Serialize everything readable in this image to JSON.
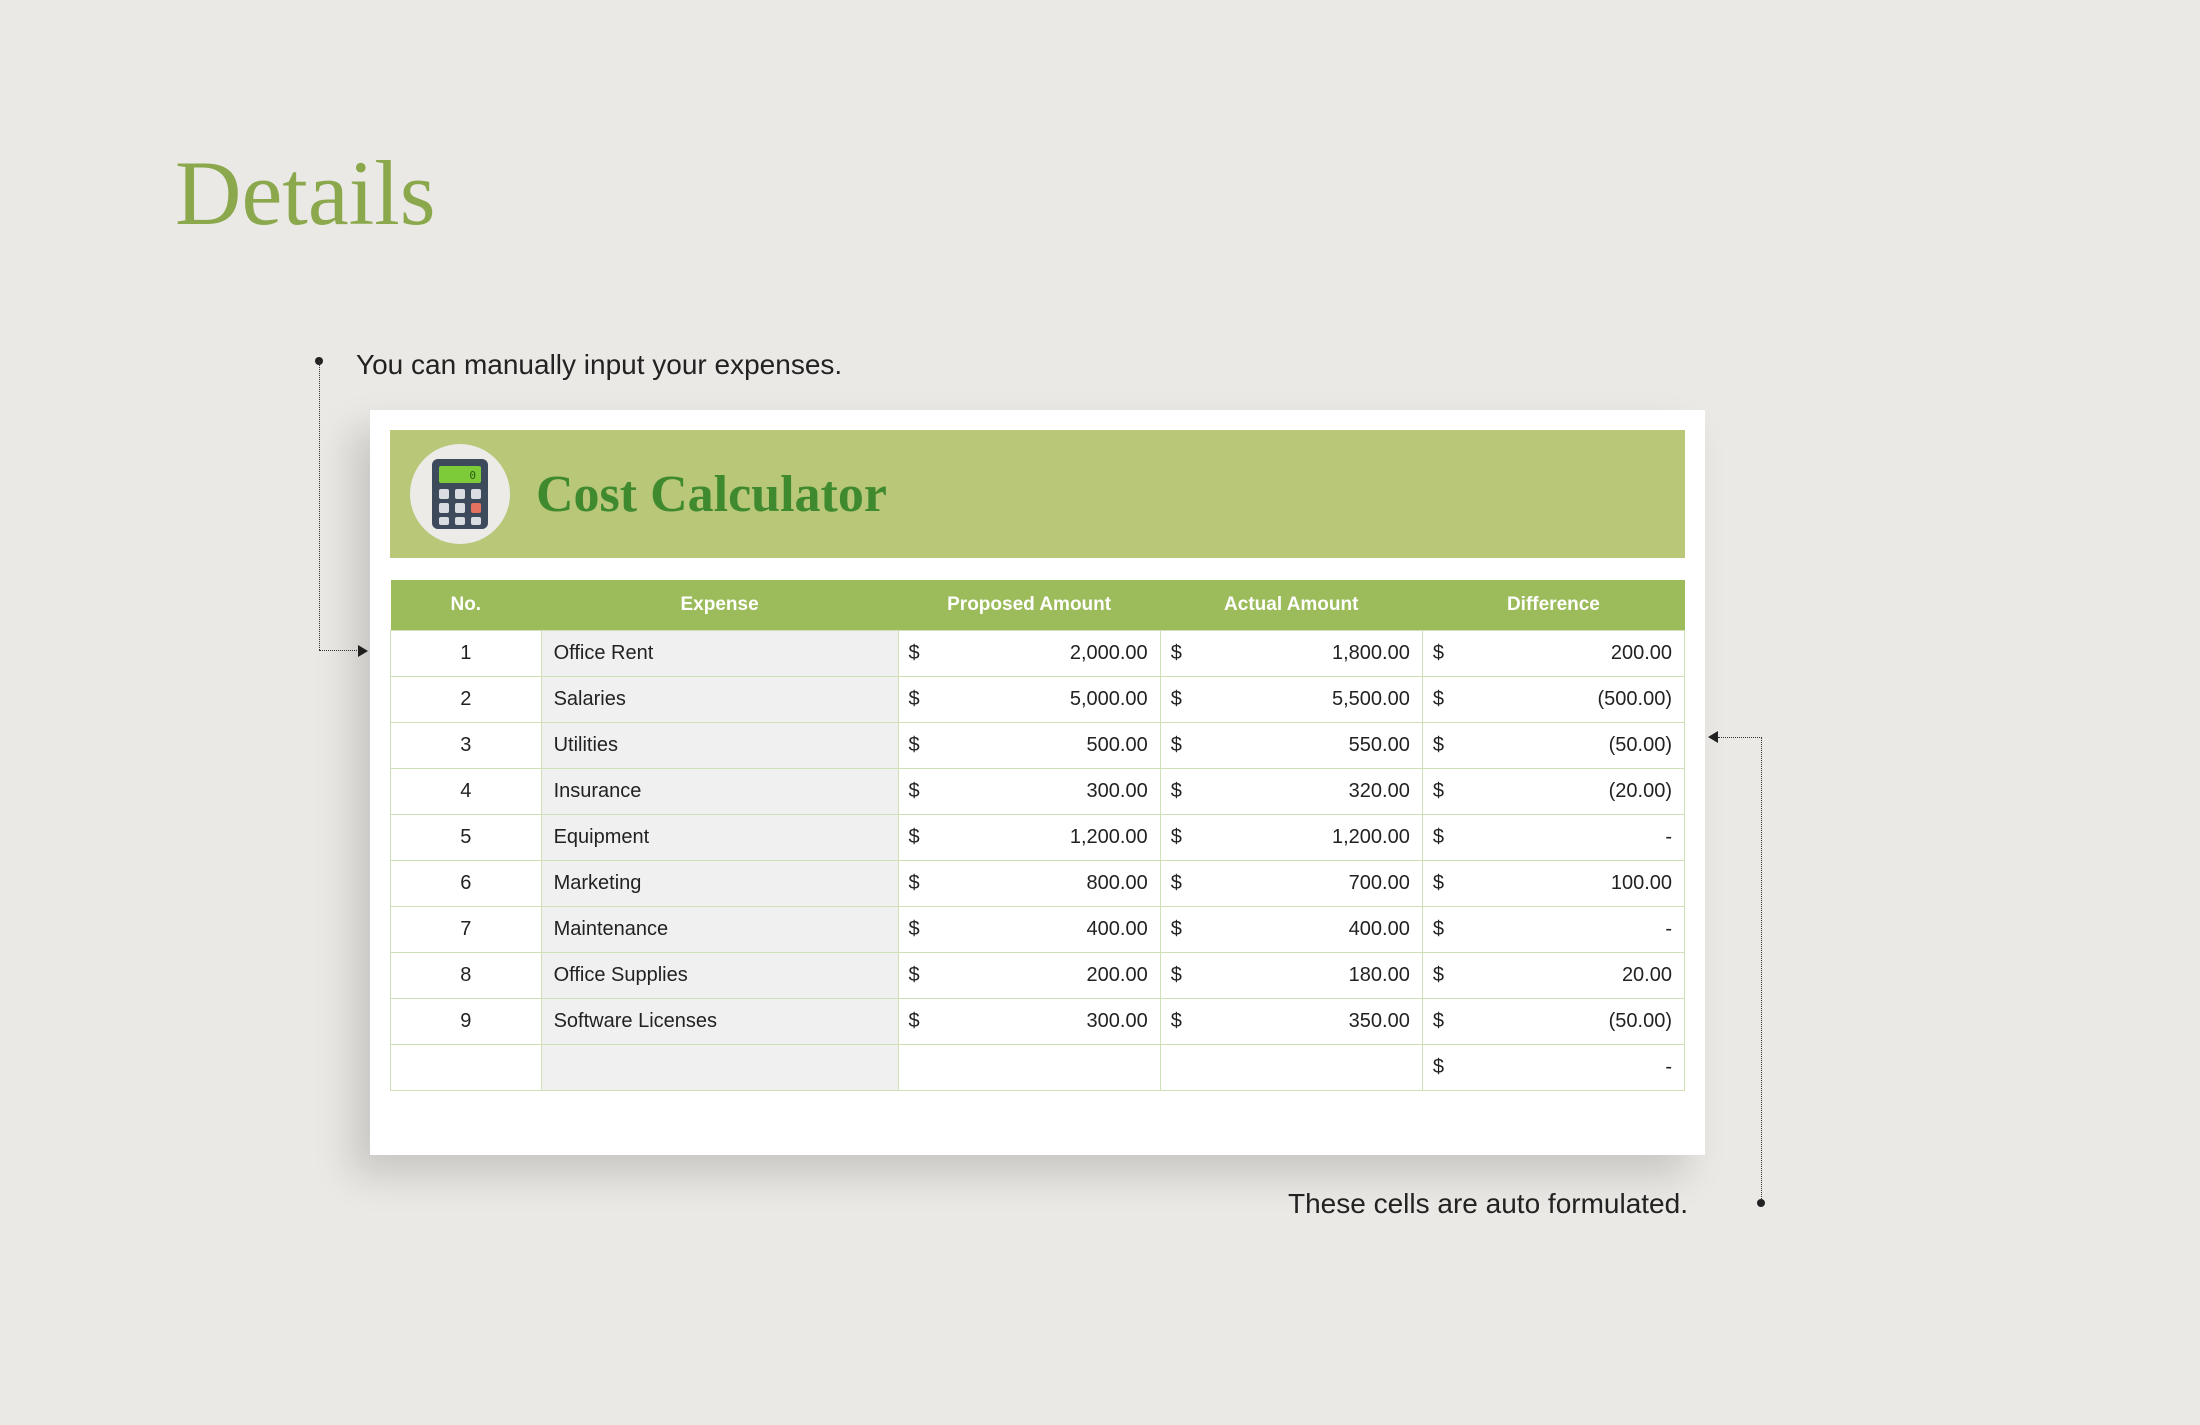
{
  "heading": "Details",
  "annotations": {
    "top": "You can manually input your expenses.",
    "bottom": "These cells are auto formulated."
  },
  "banner": {
    "title": "Cost Calculator",
    "icon": "calculator-icon"
  },
  "columns": {
    "no": "No.",
    "expense": "Expense",
    "proposed": "Proposed Amount",
    "actual": "Actual Amount",
    "difference": "Difference"
  },
  "currency_symbol": "$",
  "rows": [
    {
      "no": "1",
      "expense": "Office Rent",
      "proposed": "2,000.00",
      "actual": "1,800.00",
      "difference": "200.00"
    },
    {
      "no": "2",
      "expense": "Salaries",
      "proposed": "5,000.00",
      "actual": "5,500.00",
      "difference": "(500.00)"
    },
    {
      "no": "3",
      "expense": "Utilities",
      "proposed": "500.00",
      "actual": "550.00",
      "difference": "(50.00)"
    },
    {
      "no": "4",
      "expense": "Insurance",
      "proposed": "300.00",
      "actual": "320.00",
      "difference": "(20.00)"
    },
    {
      "no": "5",
      "expense": "Equipment",
      "proposed": "1,200.00",
      "actual": "1,200.00",
      "difference": "-"
    },
    {
      "no": "6",
      "expense": "Marketing",
      "proposed": "800.00",
      "actual": "700.00",
      "difference": "100.00"
    },
    {
      "no": "7",
      "expense": "Maintenance",
      "proposed": "400.00",
      "actual": "400.00",
      "difference": "-"
    },
    {
      "no": "8",
      "expense": "Office Supplies",
      "proposed": "200.00",
      "actual": "180.00",
      "difference": "20.00"
    },
    {
      "no": "9",
      "expense": "Software Licenses",
      "proposed": "300.00",
      "actual": "350.00",
      "difference": "(50.00)"
    }
  ],
  "trailing_row": {
    "difference": "-"
  },
  "colors": {
    "heading": "#8ba84d",
    "banner_bg": "#b8c778",
    "banner_title": "#3f8a2e",
    "header_bg": "#9cbb5b",
    "page_bg": "#ebe9e5"
  }
}
